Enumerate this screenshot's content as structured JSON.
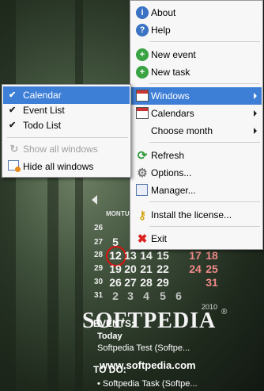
{
  "main_menu": {
    "items": [
      {
        "label": "About",
        "icon": "info-icon"
      },
      {
        "label": "Help",
        "icon": "help-icon"
      },
      {
        "label": "New event",
        "icon": "add-event-icon"
      },
      {
        "label": "New task",
        "icon": "add-task-icon"
      },
      {
        "label": "Windows",
        "icon": "windows-icon",
        "submenu": true,
        "selected": true
      },
      {
        "label": "Calendars",
        "icon": "calendars-icon",
        "submenu": true
      },
      {
        "label": "Choose month",
        "icon": "none",
        "submenu": true
      },
      {
        "label": "Refresh",
        "icon": "refresh-icon"
      },
      {
        "label": "Options...",
        "icon": "gear-icon"
      },
      {
        "label": "Manager...",
        "icon": "manager-icon"
      },
      {
        "label": "Install the license...",
        "icon": "key-icon"
      },
      {
        "label": "Exit",
        "icon": "close-icon"
      }
    ]
  },
  "windows_submenu": {
    "items": [
      {
        "label": "Calendar",
        "checked": true,
        "selected": true
      },
      {
        "label": "Event List",
        "checked": true
      },
      {
        "label": "Todo List",
        "checked": true
      },
      {
        "label": "Show all windows",
        "disabled": true,
        "icon": "show-windows-icon"
      },
      {
        "label": "Hide all windows",
        "icon": "hide-windows-icon"
      }
    ]
  },
  "calendar": {
    "day_headers": [
      "MON",
      "TUE"
    ],
    "week_numbers": [
      "26",
      "27",
      "28",
      "29",
      "30",
      "31"
    ],
    "rows": [
      [
        "",
        "",
        "",
        "",
        "",
        ""
      ],
      [
        "5",
        "",
        "",
        "",
        "",
        ""
      ],
      [
        "12",
        "13",
        "14",
        "15",
        "17",
        "18"
      ],
      [
        "19",
        "20",
        "21",
        "22",
        "24",
        "25"
      ],
      [
        "26",
        "27",
        "28",
        "29",
        "",
        "31"
      ],
      [
        "2",
        "3",
        "4",
        "5",
        "6",
        ""
      ]
    ],
    "today": "12",
    "brand": "SOFTPEDIA",
    "year": "2010",
    "registered": "®"
  },
  "events": {
    "heading": "EVENTS:",
    "group": "Today",
    "items": [
      "Softpedia Test (Softpe..."
    ]
  },
  "todo": {
    "heading": "TO DO:",
    "items": [
      "• Softpedia Task (Softpe..."
    ]
  },
  "watermark_url": "www.softpedia.com",
  "colors": {
    "selection": "#3d7fd6",
    "weekend": "#f08a8a",
    "today_ring": "#d11111"
  }
}
